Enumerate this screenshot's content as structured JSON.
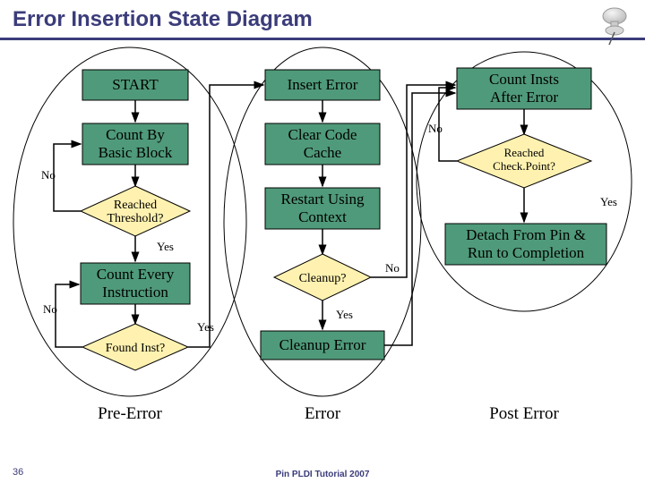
{
  "title": "Error Insertion State Diagram",
  "footer": "Pin PLDI Tutorial 2007",
  "page": "36",
  "nodes": {
    "start": "START",
    "count_bb_l1": "Count By",
    "count_bb_l2": "Basic Block",
    "reached_thresh_l1": "Reached",
    "reached_thresh_l2": "Threshold?",
    "count_every_l1": "Count Every",
    "count_every_l2": "Instruction",
    "found_inst": "Found Inst?",
    "insert_error": "Insert Error",
    "clear_cache_l1": "Clear Code",
    "clear_cache_l2": "Cache",
    "restart_l1": "Restart Using",
    "restart_l2": "Context",
    "cleanup_q": "Cleanup?",
    "cleanup_err": "Cleanup Error",
    "count_after_l1": "Count Insts",
    "count_after_l2": "After Error",
    "reached_cp_l1": "Reached",
    "reached_cp_l2": "Check.Point?",
    "detach_l1": "Detach From Pin &",
    "detach_l2": "Run to Completion"
  },
  "labels": {
    "no": "No",
    "yes": "Yes",
    "pre_error": "Pre-Error",
    "error": "Error",
    "post_error": "Post Error"
  },
  "colors": {
    "box_fill": "#4f9a7a",
    "diamond_fill": "#fff2b0",
    "title": "#3b3c7a"
  }
}
